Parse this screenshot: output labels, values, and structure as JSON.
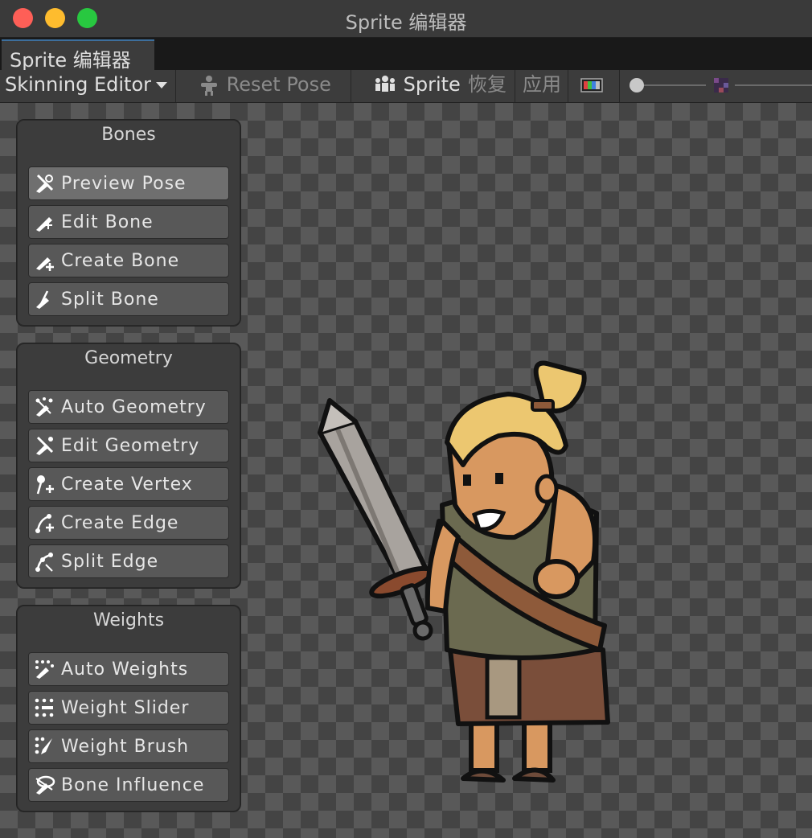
{
  "window": {
    "title": "Sprite 编辑器"
  },
  "tabs": [
    {
      "label": "Sprite 编辑器"
    }
  ],
  "toolbar": {
    "mode_label": "Skinning Editor",
    "reset_pose_label": "Reset Pose",
    "sprite_label": "Sprite",
    "revert_label": "恢复",
    "apply_label": "应用"
  },
  "panels": {
    "bones": {
      "title": "Bones",
      "items": [
        {
          "label": "Preview Pose",
          "icon": "preview-pose-icon"
        },
        {
          "label": "Edit Bone",
          "icon": "edit-bone-icon"
        },
        {
          "label": "Create Bone",
          "icon": "create-bone-icon"
        },
        {
          "label": "Split Bone",
          "icon": "split-bone-icon"
        }
      ]
    },
    "geometry": {
      "title": "Geometry",
      "items": [
        {
          "label": "Auto Geometry",
          "icon": "auto-geometry-icon"
        },
        {
          "label": "Edit Geometry",
          "icon": "edit-geometry-icon"
        },
        {
          "label": "Create Vertex",
          "icon": "create-vertex-icon"
        },
        {
          "label": "Create Edge",
          "icon": "create-edge-icon"
        },
        {
          "label": "Split Edge",
          "icon": "split-edge-icon"
        }
      ]
    },
    "weights": {
      "title": "Weights",
      "items": [
        {
          "label": "Auto Weights",
          "icon": "auto-weights-icon"
        },
        {
          "label": "Weight Slider",
          "icon": "weight-slider-icon"
        },
        {
          "label": "Weight Brush",
          "icon": "weight-brush-icon"
        },
        {
          "label": "Bone Influence",
          "icon": "bone-influence-icon"
        }
      ]
    }
  },
  "colors": {
    "active_tab_accent": "#3d6f9d",
    "panel_bg": "#3c3c3c",
    "button_bg": "#585858",
    "active_button_bg": "#6f6f6f"
  }
}
